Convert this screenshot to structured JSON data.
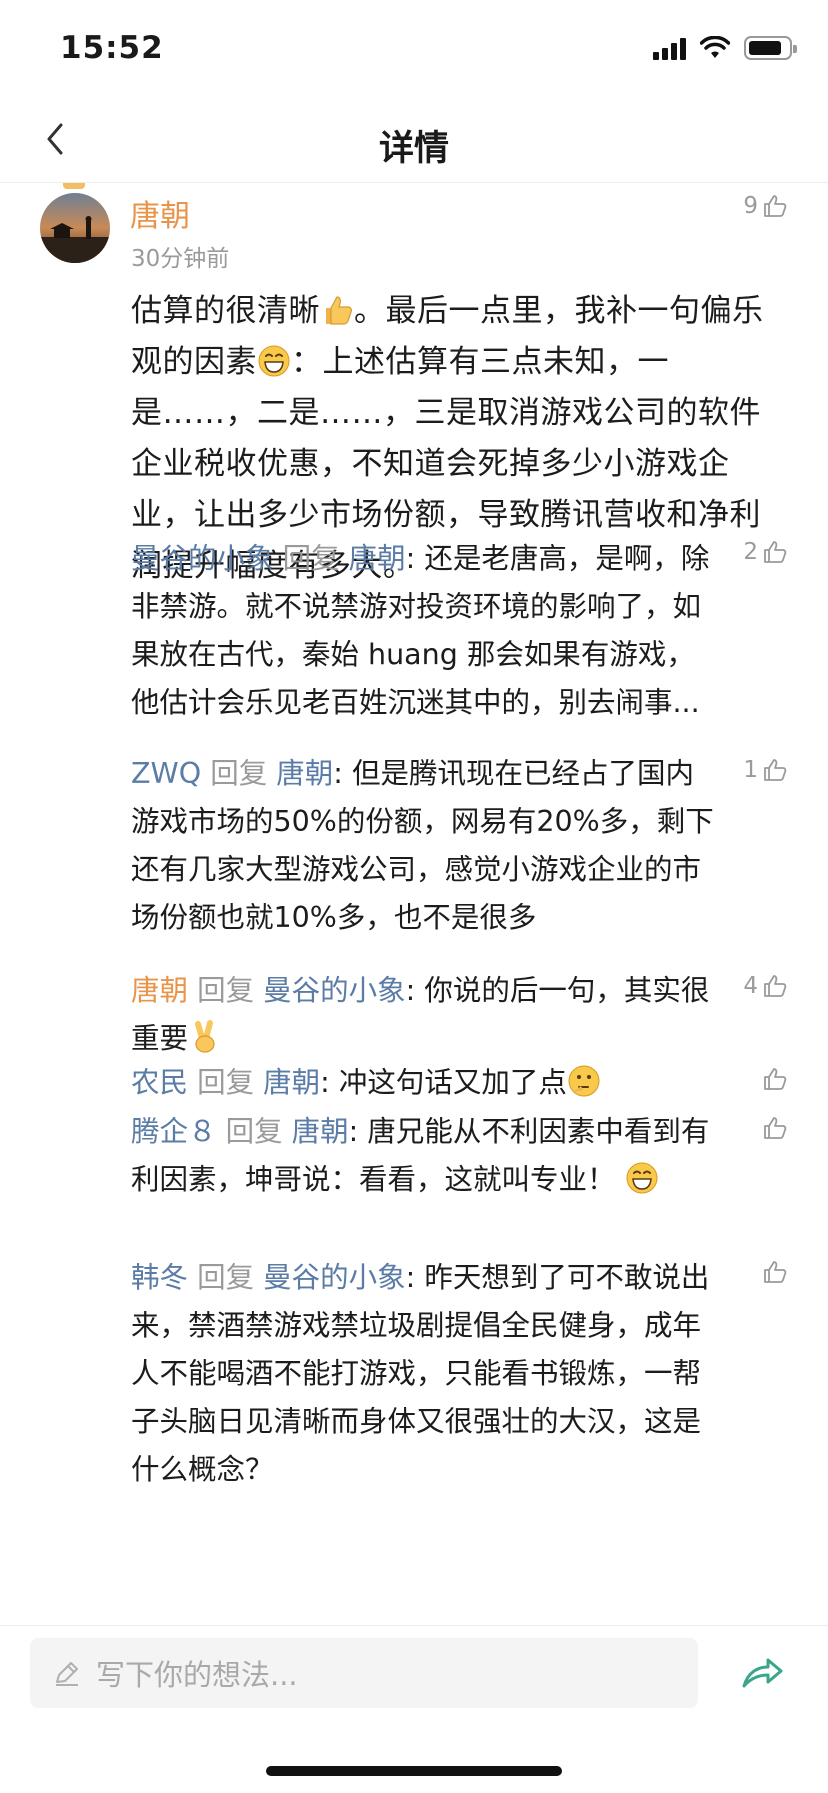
{
  "status_bar": {
    "time": "15:52"
  },
  "nav": {
    "title": "详情"
  },
  "post": {
    "author": "唐朝",
    "time": "30分钟前",
    "likes": "9",
    "body": [
      {
        "t": "估算的很清晰"
      },
      {
        "emoji": "thumbs-up-emoji"
      },
      {
        "t": "。最后一点里，我补一句偏乐观的因素"
      },
      {
        "emoji": "grinning-emoji"
      },
      {
        "t": "：上述估算有三点未知，一是……，二是……，三是取消游戏公司的软件企业税收优惠，不知道会死掉多少小游戏企业，让出多少市场份额，导致腾讯营收和净利润提升幅度有多大。"
      }
    ]
  },
  "reply_word": "回复",
  "replies": [
    {
      "from": "曼谷的小象",
      "to": "唐朝",
      "likes": "2",
      "text": ": 还是老唐高，是啊，除非禁游。就不说禁游对投资环境的影响了，如果放在古代，秦始 huang 那会如果有游戏，他估计会乐见老百姓沉迷其中的，别去闹事...",
      "emoji_after": ""
    },
    {
      "from": "ZWQ",
      "to": "唐朝",
      "likes": "1",
      "text": ": 但是腾讯现在已经占了国内游戏市场的50%的份额，网易有20%多，剩下还有几家大型游戏公司，感觉小游戏企业的市场份额也就10%多，也不是很多",
      "emoji_after": ""
    },
    {
      "from": "唐朝",
      "to": "曼谷的小象",
      "likes": "4",
      "text": ": 你说的后一句，其实很重要",
      "emoji_after": "victory-hand-emoji"
    },
    {
      "from": "农民",
      "to": "唐朝",
      "likes": "",
      "text": ": 冲这句话又加了点",
      "emoji_after": "thinking-emoji"
    },
    {
      "from": "腾企８",
      "to": "唐朝",
      "likes": "",
      "text": ": 唐兄能从不利因素中看到有利因素，坤哥说：看看，这就叫专业！ ",
      "emoji_after": "grinning-emoji"
    },
    {
      "from": "韩冬",
      "to": "曼谷的小象",
      "likes": "",
      "text": ": 昨天想到了可不敢说出来，禁酒禁游戏禁垃圾剧提倡全民健身，成年人不能喝酒不能打游戏，只能看书锻炼，一帮子头脑日见清晰而身体又很强壮的大汉，这是什么概念？",
      "emoji_after": ""
    }
  ],
  "composer": {
    "placeholder": "写下你的想法..."
  },
  "colors": {
    "name_orange": "#e8944a",
    "name_blue": "#5b7ca6",
    "muted": "#9a9a9a",
    "share_green": "#3aa58a"
  }
}
